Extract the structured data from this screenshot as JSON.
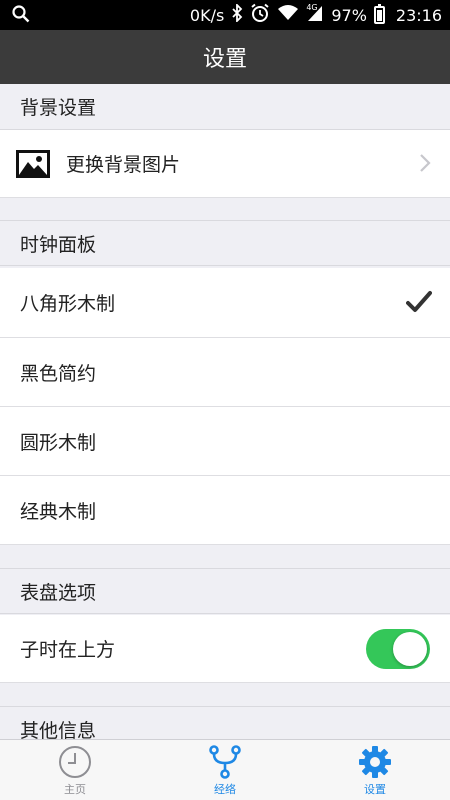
{
  "status_bar": {
    "net_speed": "0K/s",
    "network_type": "4G",
    "battery": "97%",
    "time": "23:16"
  },
  "header": {
    "title": "设置"
  },
  "sections": {
    "background": {
      "title": "背景设置",
      "items": [
        {
          "label": "更换背景图片",
          "icon": "picture-icon"
        }
      ]
    },
    "clock_panel": {
      "title": "时钟面板",
      "items": [
        {
          "label": "八角形木制",
          "selected": true
        },
        {
          "label": "黑色简约",
          "selected": false
        },
        {
          "label": "圆形木制",
          "selected": false
        },
        {
          "label": "经典木制",
          "selected": false
        }
      ]
    },
    "dial_options": {
      "title": "表盘选项",
      "items": [
        {
          "label": "子时在上方",
          "toggle_on": true
        }
      ]
    },
    "other_info": {
      "title": "其他信息"
    }
  },
  "tab_bar": {
    "tabs": [
      {
        "label": "主页",
        "icon": "clock-icon",
        "active": false
      },
      {
        "label": "经络",
        "icon": "meridian-icon",
        "active": false
      },
      {
        "label": "设置",
        "icon": "gear-icon",
        "active": true
      }
    ]
  },
  "colors": {
    "title_bar": "#3b3b3b",
    "accent": "#1e88e5",
    "toggle_on": "#34c759",
    "background": "#efeff4"
  }
}
